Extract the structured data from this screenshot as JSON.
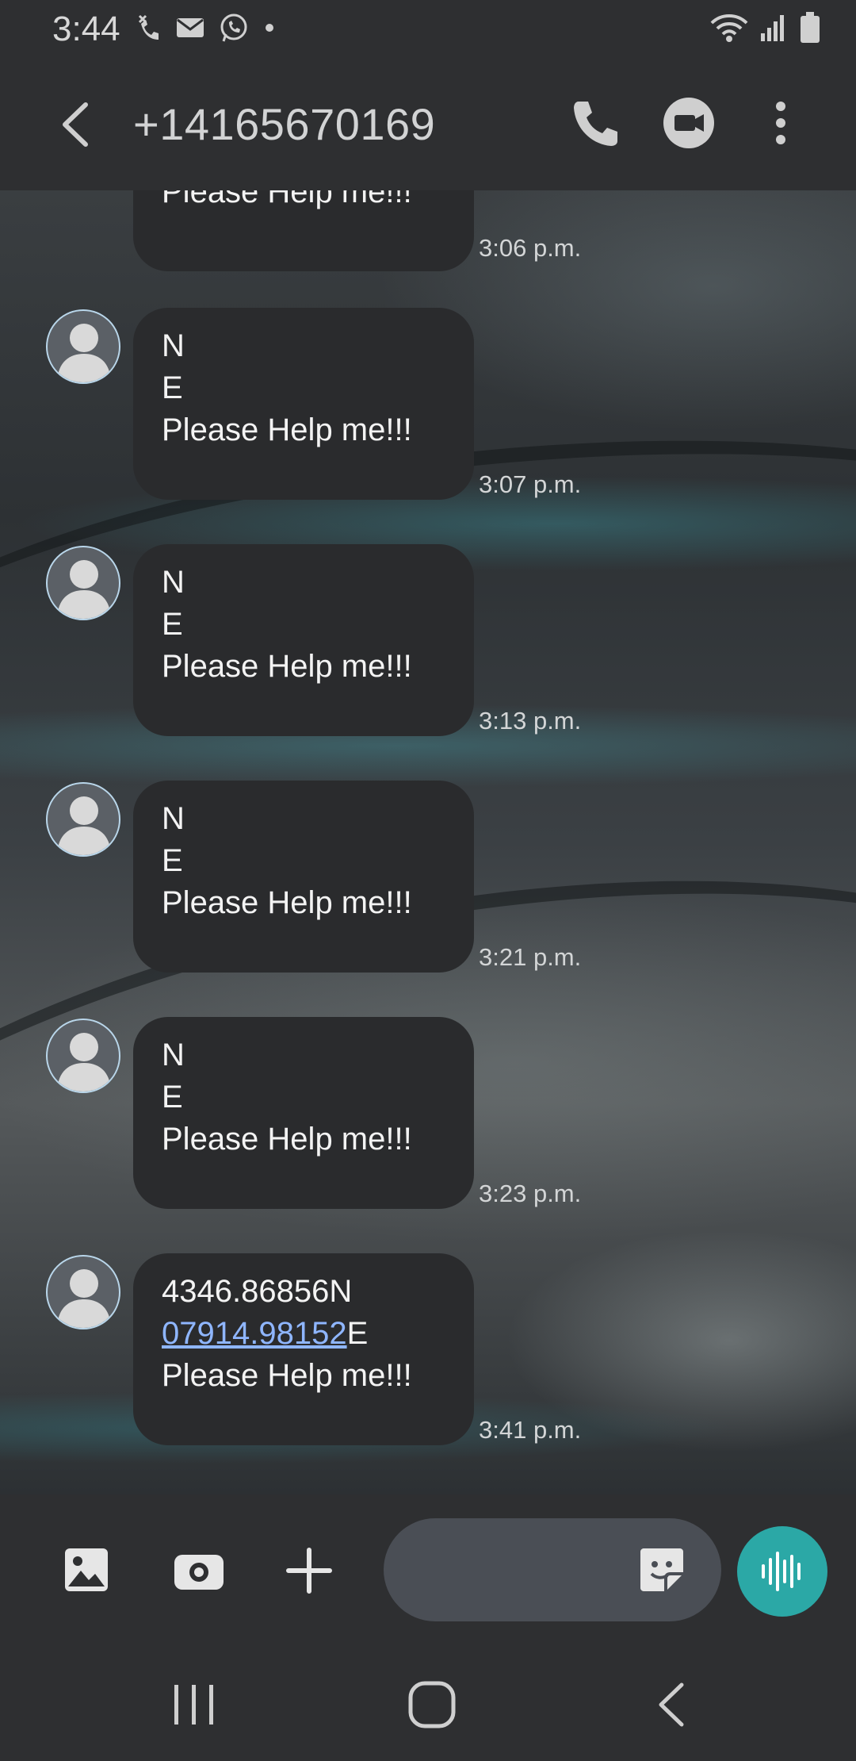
{
  "status_bar": {
    "time": "3:44",
    "left_icons": [
      "missed-call-icon",
      "mail-icon",
      "whatsapp-icon",
      "dot-icon"
    ],
    "right_icons": [
      "wifi-icon",
      "signal-icon",
      "battery-icon"
    ]
  },
  "header": {
    "title": "+14165670169",
    "actions": [
      "back-icon",
      "phone-icon",
      "video-call-icon",
      "more-icon"
    ]
  },
  "messages": [
    {
      "lines": [
        "Please Help me!!!"
      ],
      "time": "3:06 p.m."
    },
    {
      "lines": [
        "N",
        "E",
        "Please Help me!!!"
      ],
      "time": "3:07 p.m."
    },
    {
      "lines": [
        "N",
        "E",
        "Please Help me!!!"
      ],
      "time": "3:13 p.m."
    },
    {
      "lines": [
        "N",
        "E",
        "Please Help me!!!"
      ],
      "time": "3:21 p.m."
    },
    {
      "lines": [
        "N",
        "E",
        "Please Help me!!!"
      ],
      "time": "3:23 p.m."
    },
    {
      "lines": [
        "4346.86856N",
        "07914.98152",
        "E",
        "Please Help me!!!"
      ],
      "time": "3:41 p.m."
    }
  ],
  "compose": {
    "placeholder": "",
    "icons": [
      "gallery-icon",
      "camera-icon",
      "add-icon",
      "sticker-icon",
      "voice-icon"
    ]
  },
  "colors": {
    "bar_bg": "#2e2f31",
    "bubble_bg": "#2a2b2d",
    "link": "#8fb6ff",
    "voice_button": "#2ba8a6",
    "input_bg": "#4a4e55"
  }
}
